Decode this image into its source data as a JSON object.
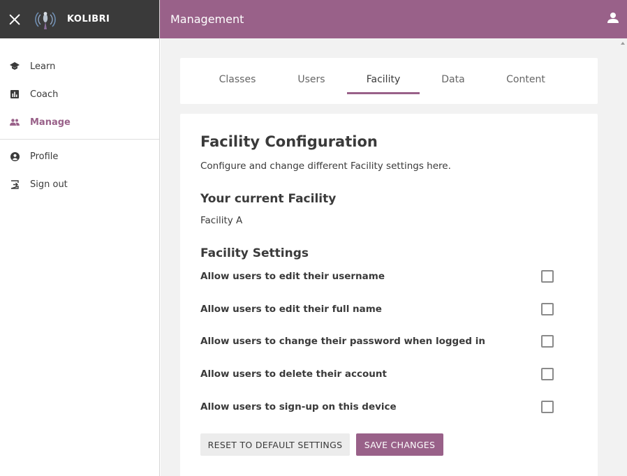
{
  "sidebar": {
    "brand": "KOLIBRI",
    "items": [
      {
        "label": "Learn",
        "icon": "learn-icon"
      },
      {
        "label": "Coach",
        "icon": "coach-icon"
      },
      {
        "label": "Manage",
        "icon": "manage-icon",
        "active": true
      },
      {
        "label": "Profile",
        "icon": "profile-icon"
      },
      {
        "label": "Sign out",
        "icon": "sign-out-icon"
      }
    ]
  },
  "appbar": {
    "title": "Management"
  },
  "tabs": [
    {
      "label": "Classes"
    },
    {
      "label": "Users"
    },
    {
      "label": "Facility",
      "active": true
    },
    {
      "label": "Data"
    },
    {
      "label": "Content"
    }
  ],
  "content": {
    "title": "Facility Configuration",
    "description": "Configure and change different Facility settings here.",
    "current_heading": "Your current Facility",
    "current_facility": "Facility A",
    "settings_heading": "Facility Settings",
    "settings": [
      {
        "label": "Allow users to edit their username",
        "checked": false
      },
      {
        "label": "Allow users to edit their full name",
        "checked": false
      },
      {
        "label": "Allow users to change their password when logged in",
        "checked": false
      },
      {
        "label": "Allow users to delete their account",
        "checked": false
      },
      {
        "label": "Allow users to sign-up on this device",
        "checked": false
      }
    ],
    "reset_label": "Reset to default settings",
    "save_label": "Save changes"
  },
  "colors": {
    "primary": "#996189",
    "sidebar_header": "#3a3a3a",
    "background": "#f2f2f2"
  }
}
